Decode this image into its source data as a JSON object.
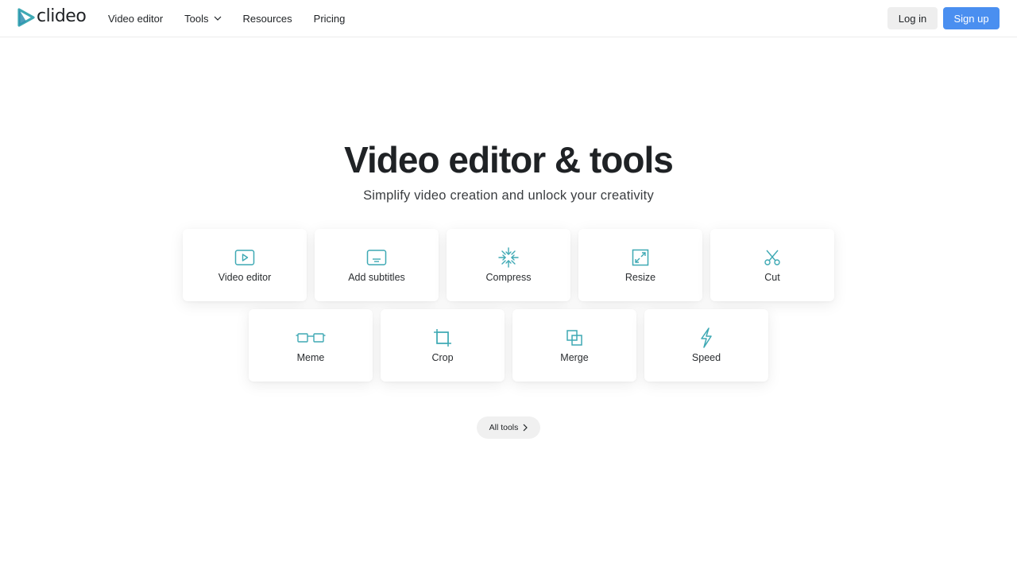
{
  "brand": {
    "name": "clideo",
    "accent": "#3ea9b4",
    "primary": "#4a8ff0"
  },
  "nav": {
    "items": [
      {
        "label": "Video editor"
      },
      {
        "label": "Tools",
        "has_dropdown": true
      },
      {
        "label": "Resources"
      },
      {
        "label": "Pricing"
      }
    ],
    "login_label": "Log in",
    "signup_label": "Sign up"
  },
  "hero": {
    "title": "Video editor & tools",
    "subtitle": "Simplify video creation and unlock your creativity"
  },
  "tools": {
    "row1": [
      {
        "label": "Video editor",
        "icon": "play-icon"
      },
      {
        "label": "Add subtitles",
        "icon": "subtitles-icon"
      },
      {
        "label": "Compress",
        "icon": "compress-icon"
      },
      {
        "label": "Resize",
        "icon": "resize-icon"
      },
      {
        "label": "Cut",
        "icon": "scissors-icon"
      }
    ],
    "row2": [
      {
        "label": "Meme",
        "icon": "meme-icon"
      },
      {
        "label": "Crop",
        "icon": "crop-icon"
      },
      {
        "label": "Merge",
        "icon": "merge-icon"
      },
      {
        "label": "Speed",
        "icon": "lightning-icon"
      }
    ],
    "all_tools_label": "All tools"
  }
}
